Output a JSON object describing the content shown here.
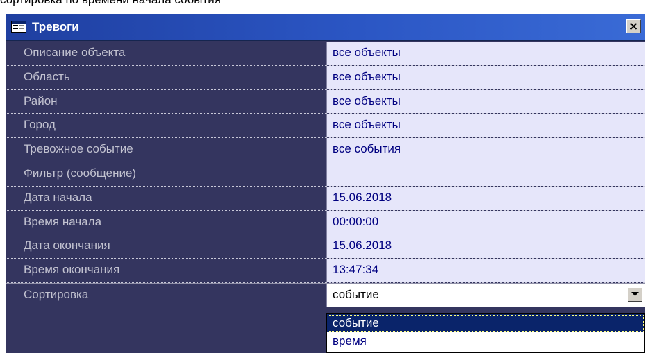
{
  "caption": "сортировка по времени начала события",
  "window": {
    "title": "Тревоги",
    "close_label": "×"
  },
  "rows": [
    {
      "label": "Описание объекта",
      "value": "все объекты"
    },
    {
      "label": "Область",
      "value": "все объекты"
    },
    {
      "label": "Район",
      "value": "все объекты"
    },
    {
      "label": "Город",
      "value": "все объекты"
    },
    {
      "label": "Тревожное событие",
      "value": "все события"
    },
    {
      "label": "Фильтр (сообщение)",
      "value": ""
    },
    {
      "label": "Дата начала",
      "value": "15.06.2018"
    },
    {
      "label": "Время начала",
      "value": "00:00:00"
    },
    {
      "label": "Дата окончания",
      "value": "15.06.2018"
    },
    {
      "label": "Время окончания",
      "value": "13:47:34"
    }
  ],
  "sort": {
    "label": "Сортировка",
    "selected": "событие",
    "options": [
      "событие",
      "время"
    ]
  },
  "colors": {
    "grid_bg": "#34355f",
    "value_bg": "#e6e6fa",
    "value_text": "#000080",
    "titlebar": "#2b56c4",
    "highlight": "#0a246a"
  },
  "icons": {
    "window": "window-icon",
    "close": "close-icon",
    "dropdown": "chevron-down-icon"
  }
}
